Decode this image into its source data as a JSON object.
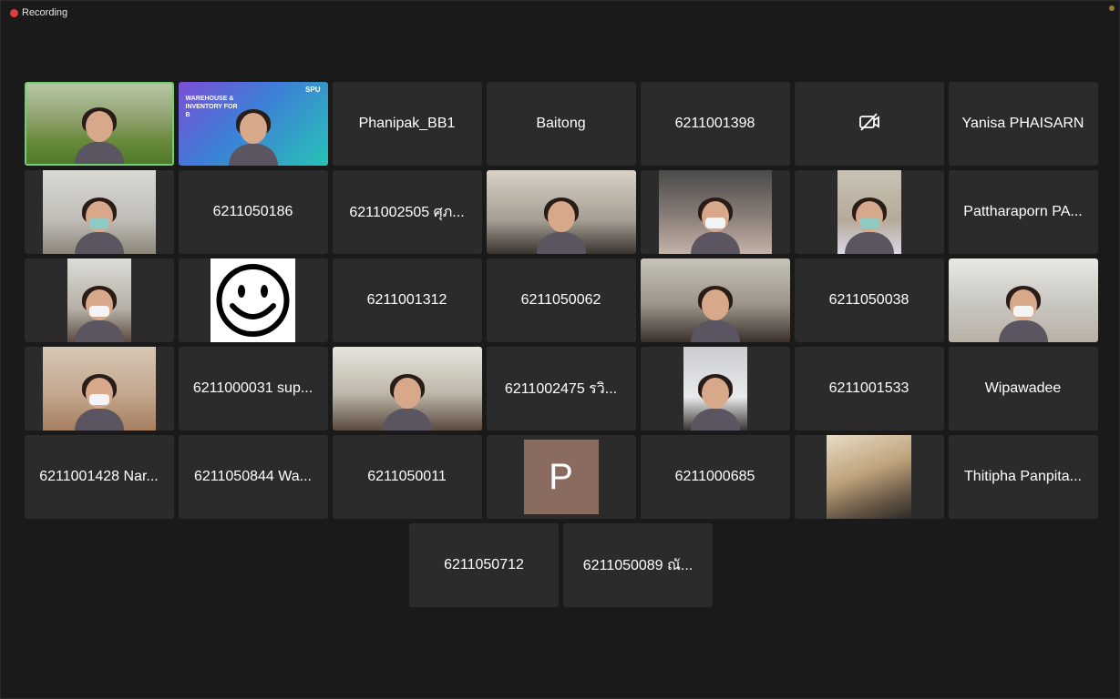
{
  "recording": {
    "label": "Recording",
    "indicator_color": "#e23b3b"
  },
  "rows": [
    [
      {
        "type": "video",
        "bg": "v-forest",
        "active": true
      },
      {
        "type": "video",
        "bg": "v-slide",
        "slide_text": "WAREHOUSE &\nINVENTORY FOR\nB",
        "slide_logo": "SPU"
      },
      {
        "type": "name",
        "label": "Phanipak_BB1"
      },
      {
        "type": "name",
        "label": "Baitong"
      },
      {
        "type": "name",
        "label": "6211001398"
      },
      {
        "type": "icon",
        "icon": "video-off-icon"
      },
      {
        "type": "name",
        "label": "Yanisa PHAISARN"
      }
    ],
    [
      {
        "type": "video",
        "bg": "v-room1",
        "mask": "green"
      },
      {
        "type": "name",
        "label": "6211050186"
      },
      {
        "type": "name",
        "label": "6211002505 ศุภ..."
      },
      {
        "type": "video",
        "bg": "v-room2"
      },
      {
        "type": "video",
        "bg": "v-room3",
        "mask": "white"
      },
      {
        "type": "video",
        "bg": "v-room4",
        "mask": "green"
      },
      {
        "type": "name",
        "label": "Pattharaporn PA..."
      }
    ],
    [
      {
        "type": "video",
        "bg": "v-room5",
        "mask": "white"
      },
      {
        "type": "smile"
      },
      {
        "type": "name",
        "label": "6211001312"
      },
      {
        "type": "name",
        "label": "6211050062"
      },
      {
        "type": "video",
        "bg": "v-room6"
      },
      {
        "type": "name",
        "label": "6211050038"
      },
      {
        "type": "video",
        "bg": "v-room7",
        "mask": "white"
      }
    ],
    [
      {
        "type": "video",
        "bg": "v-room8",
        "mask": "white"
      },
      {
        "type": "name",
        "label": "6211000031 sup..."
      },
      {
        "type": "video",
        "bg": "v-room9"
      },
      {
        "type": "name",
        "label": "6211002475 รวิ..."
      },
      {
        "type": "video",
        "bg": "v-room10"
      },
      {
        "type": "name",
        "label": "6211001533"
      },
      {
        "type": "name",
        "label": "Wipawadee"
      }
    ],
    [
      {
        "type": "name",
        "label": "6211001428 Nar..."
      },
      {
        "type": "name",
        "label": "6211050844 Wa..."
      },
      {
        "type": "name",
        "label": "6211050011"
      },
      {
        "type": "avatar",
        "letter": "P"
      },
      {
        "type": "name",
        "label": "6211000685"
      },
      {
        "type": "video",
        "bg": "v-book"
      },
      {
        "type": "name",
        "label": "Thitipha Panpita..."
      }
    ],
    [
      {
        "type": "name",
        "label": "6211050712"
      },
      {
        "type": "name",
        "label": "6211050089 ณั..."
      }
    ]
  ]
}
